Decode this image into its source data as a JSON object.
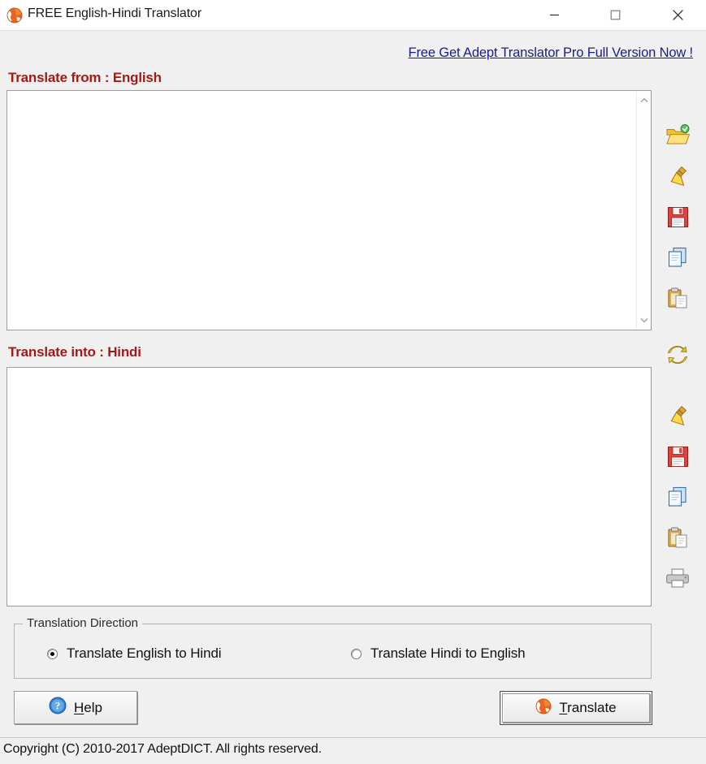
{
  "window": {
    "title": "FREE English-Hindi Translator",
    "app_icon": "globe-icon",
    "minimize_label": "Minimize",
    "maximize_label": "Maximize",
    "close_label": "Close"
  },
  "promo": {
    "link_text": "Free Get Adept Translator Pro Full Version Now !",
    "color": "#1b1b8f"
  },
  "source": {
    "label": "Translate from : English",
    "value": "",
    "placeholder": ""
  },
  "target": {
    "label": "Translate into : Hindi",
    "value": "",
    "placeholder": ""
  },
  "labels_color": "#9e1b1b",
  "source_toolbar": [
    {
      "name": "open-file-icon",
      "tooltip": "Open"
    },
    {
      "name": "clear-icon",
      "tooltip": "Clear"
    },
    {
      "name": "save-icon",
      "tooltip": "Save"
    },
    {
      "name": "copy-icon",
      "tooltip": "Copy"
    },
    {
      "name": "paste-icon",
      "tooltip": "Paste"
    }
  ],
  "target_toolbar": [
    {
      "name": "swap-refresh-icon",
      "tooltip": "Swap"
    },
    {
      "name": "clear-icon",
      "tooltip": "Clear"
    },
    {
      "name": "save-icon",
      "tooltip": "Save"
    },
    {
      "name": "copy-icon",
      "tooltip": "Copy"
    },
    {
      "name": "paste-icon",
      "tooltip": "Paste"
    },
    {
      "name": "print-icon",
      "tooltip": "Print"
    }
  ],
  "direction": {
    "legend": "Translation Direction",
    "options": [
      {
        "label": "Translate English to Hindi",
        "selected": true
      },
      {
        "label": "Translate Hindi to English",
        "selected": false
      }
    ]
  },
  "buttons": {
    "help": {
      "label_pre": "",
      "accel": "H",
      "label_post": "elp",
      "icon": "help-question-icon"
    },
    "translate": {
      "label_pre": "",
      "accel": "T",
      "label_post": "ranslate",
      "icon": "globe-icon",
      "is_default": true
    }
  },
  "status": {
    "text": "Copyright (C) 2010-2017 AdeptDICT. All rights reserved."
  }
}
